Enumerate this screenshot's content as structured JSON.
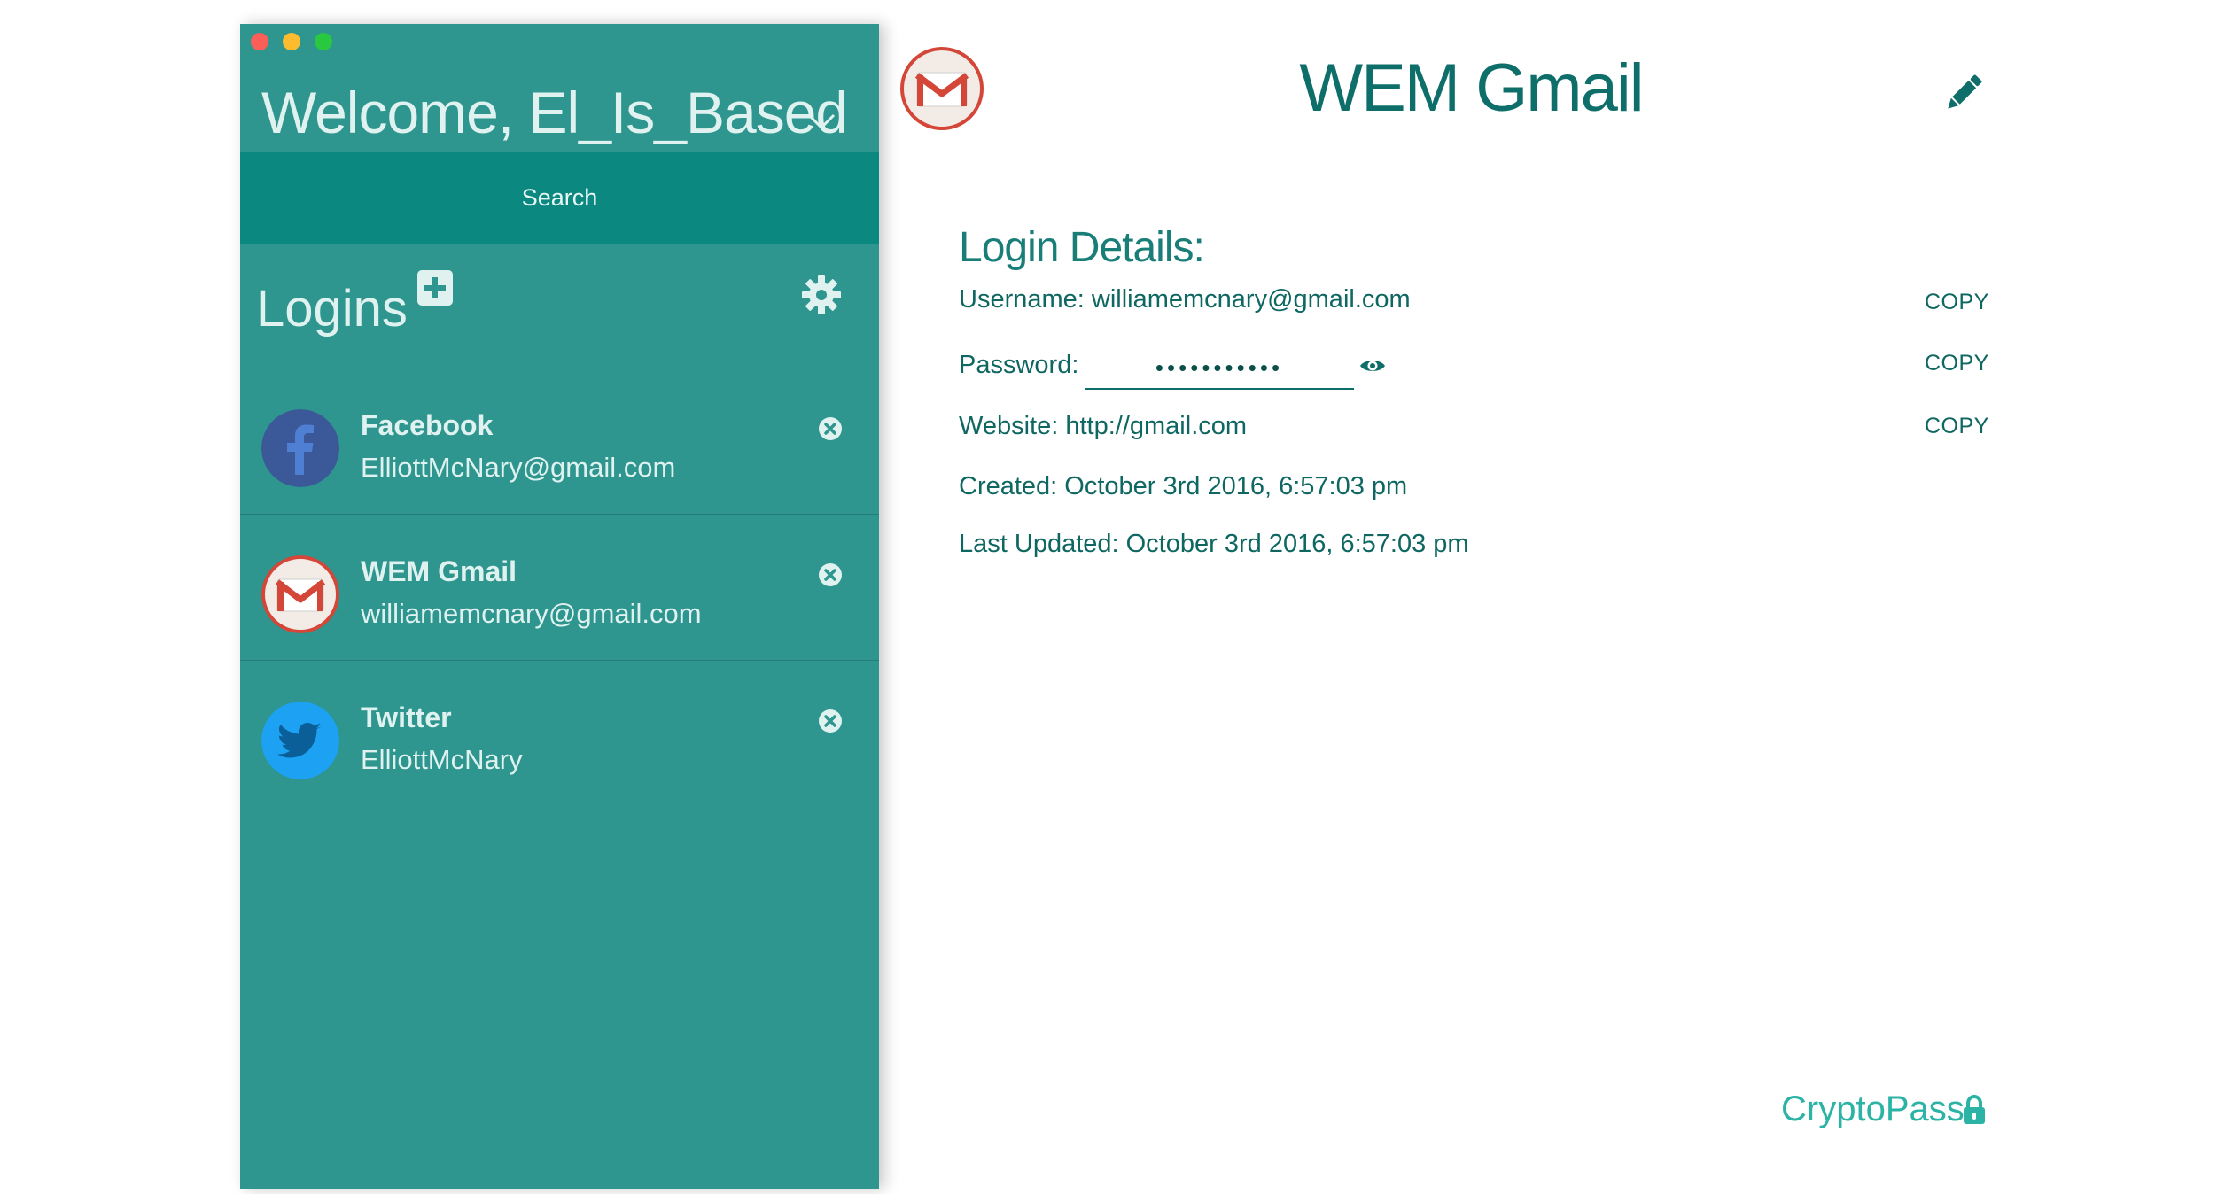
{
  "sidebar": {
    "welcome": "Welcome, El_Is_Based",
    "search": {
      "placeholder": "Search"
    },
    "logins_title": "Logins",
    "items": [
      {
        "name": "Facebook",
        "username": "ElliottMcNary@gmail.com",
        "icon": "facebook-icon"
      },
      {
        "name": "WEM Gmail",
        "username": "williamemcnary@gmail.com",
        "icon": "gmail-icon"
      },
      {
        "name": "Twitter",
        "username": "ElliottMcNary",
        "icon": "twitter-icon"
      }
    ]
  },
  "main": {
    "title": "WEM Gmail",
    "details_title": "Login Details:",
    "username": "Username: williamemcnary@gmail.com",
    "password_label": "Password:",
    "password_value": "•••••••••••",
    "website": "Website: http://gmail.com",
    "created": "Created: October 3rd 2016, 6:57:03 pm",
    "updated": "Last Updated: October 3rd 2016, 6:57:03 pm",
    "copy_label": "COPY"
  },
  "brand": "CryptoPass",
  "colors": {
    "sidebar": "#2e958f",
    "search": "#0b8981",
    "accent": "#0e6f6a",
    "brand": "#2bb3a6",
    "facebook": "#3b5998",
    "twitter": "#1da1f2",
    "gmail": "#d44638"
  }
}
